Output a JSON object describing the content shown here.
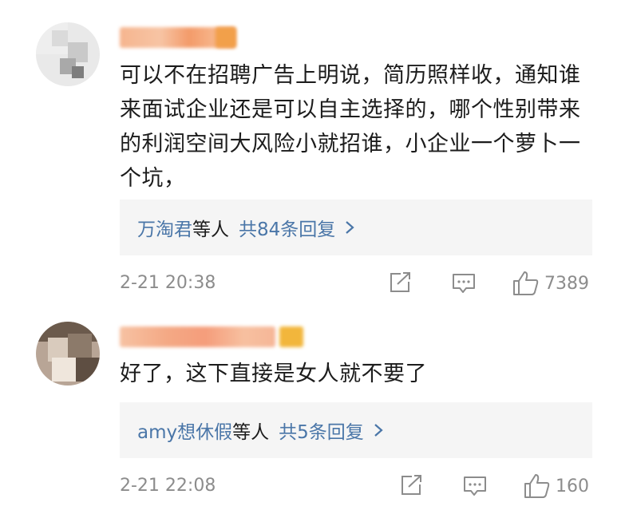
{
  "comments": [
    {
      "text": "可以不在招聘广告上明说，简历照样收，通知谁来面试企业还是可以自主选择的，哪个性别带来的利润空间大风险小就招谁，小企业一个萝卜一个坑，",
      "replies": {
        "users": "万淘君",
        "suffix": "等人",
        "count": "共84条回复"
      },
      "time": "2-21 20:38",
      "likes": "7389"
    },
    {
      "text": "好了，这下直接是女人就不要了",
      "replies": {
        "users": "amy想休假",
        "suffix": "等人",
        "count": "共5条回复"
      },
      "time": "2-21 22:08",
      "likes": "160"
    }
  ],
  "icons": {
    "share": "share-icon",
    "comment": "comment-icon",
    "like": "like-icon",
    "chevron": "chevron-right-icon"
  },
  "colors": {
    "link": "#4a76a8",
    "meta": "#8c8c8c",
    "reply_bg": "#f5f5f5",
    "name_blur": "#f3a073"
  }
}
